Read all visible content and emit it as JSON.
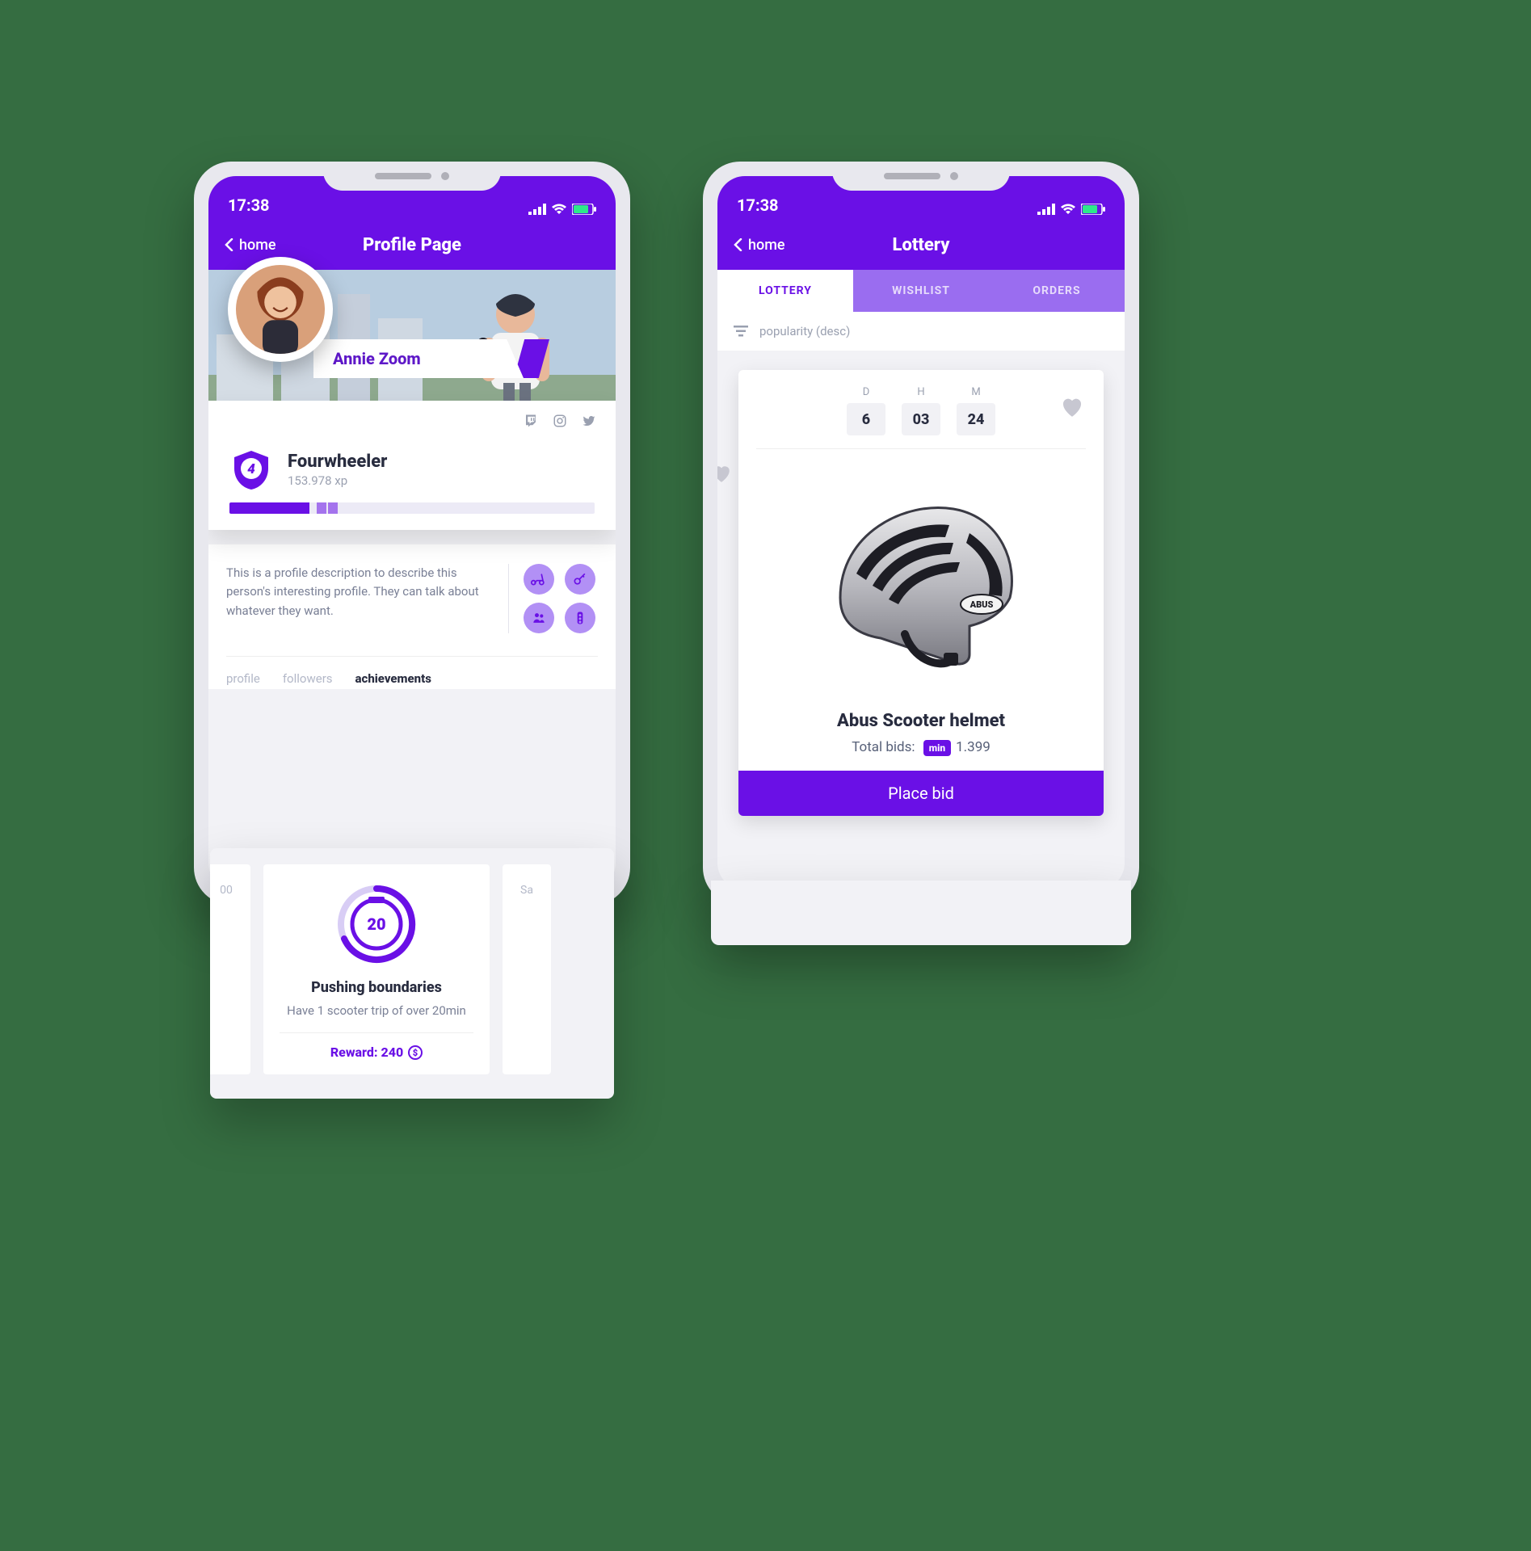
{
  "statusbar": {
    "time": "17:38"
  },
  "profile": {
    "nav": {
      "back": "home",
      "title": "Profile Page"
    },
    "name": "Annie Zoom",
    "rank_title": "Fourwheeler",
    "rank_level": "4",
    "rank_xp": "153.978 xp",
    "description": "This is a profile description to describe this person's interesting profile. They can talk about whatever they want.",
    "subtabs": {
      "profile": "profile",
      "followers": "followers",
      "achievements": "achievements"
    }
  },
  "achievement": {
    "icon_number": "20",
    "title": "Pushing boundaries",
    "subtitle": "Have 1 scooter trip of over 20min",
    "reward_label": "Reward: 240",
    "left_peek": "00",
    "right_peek": "Sa"
  },
  "lottery": {
    "nav": {
      "back": "home",
      "title": "Lottery"
    },
    "tabs": {
      "lottery": "LOTTERY",
      "wishlist": "WISHLIST",
      "orders": "ORDERS"
    },
    "filter": "popularity (desc)",
    "countdown": {
      "d_label": "D",
      "h_label": "H",
      "m_label": "M",
      "d": "6",
      "h": "03",
      "m": "24"
    },
    "product": {
      "title": "Abus Scooter helmet",
      "bids_label": "Total bids:",
      "bids_pill": "min",
      "bids_value": "1.399"
    },
    "cta": "Place bid"
  }
}
